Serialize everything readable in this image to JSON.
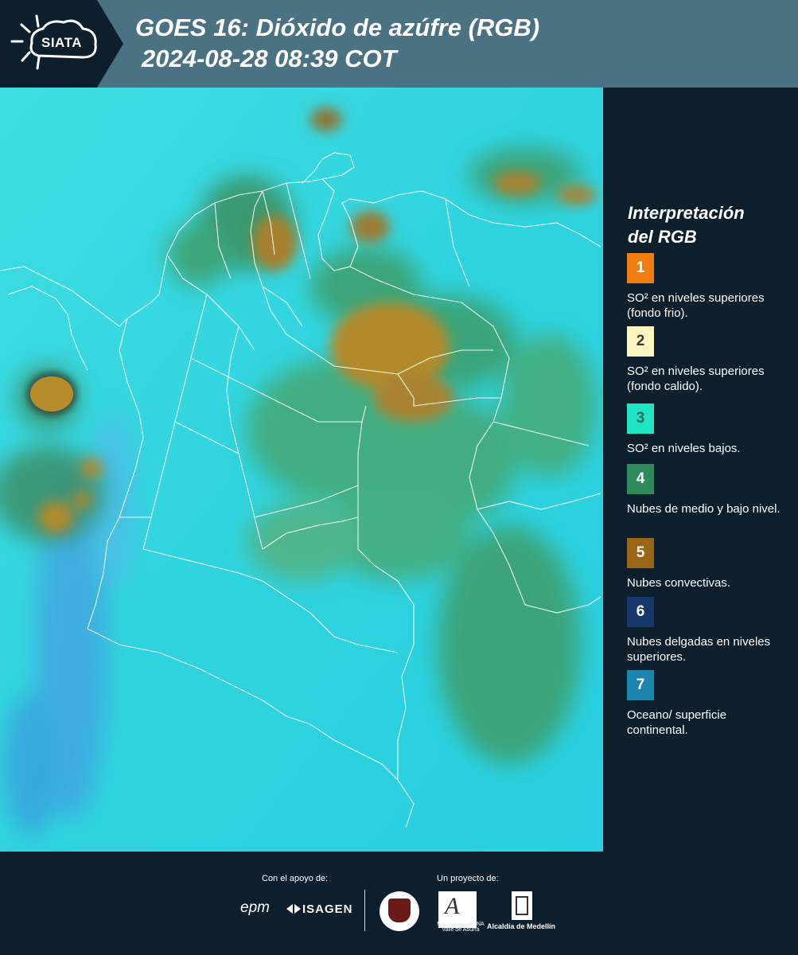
{
  "header": {
    "logo_text": "SIATA",
    "title_line1": "GOES 16: Dióxido de azúfre (RGB)",
    "title_line2": "2024-08-28 08:39 COT"
  },
  "legend": {
    "title_line1": "Interpretación",
    "title_line2": "del RGB",
    "items": [
      {
        "number": "1",
        "color": "#f07d10",
        "number_color": "#ffffff",
        "text": "SO² en niveles superiores (fondo frio)."
      },
      {
        "number": "2",
        "color": "#fdf5c0",
        "number_color": "#3a3a3a",
        "text": "SO² en niveles superiores (fondo calido)."
      },
      {
        "number": "3",
        "color": "#1ee6c4",
        "number_color": "#2a6a60",
        "text": "SO² en niveles bajos."
      },
      {
        "number": "4",
        "color": "#2f8a5c",
        "number_color": "#ffffff",
        "text": "Nubes de medio y bajo nivel."
      },
      {
        "number": "5",
        "color": "#9a6516",
        "number_color": "#ffffff",
        "text": "Nubes convectivas."
      },
      {
        "number": "6",
        "color": "#17386b",
        "number_color": "#ffffff",
        "text": "Nubes delgadas en niveles superiores."
      },
      {
        "number": "7",
        "color": "#1a86ad",
        "number_color": "#ffffff",
        "text": "Oceano/ superficie continental."
      }
    ]
  },
  "footer": {
    "support_label": "Con el apoyo de:",
    "project_label": "Un proyecto de:",
    "epm": "epm",
    "isagen": "ISAGEN",
    "area_text": "METROPOLITANA Valle de Aburrá",
    "alcaldia": "Alcaldía de Medellín"
  },
  "colors": {
    "background": "#0d1f2d",
    "header": "#4a7282",
    "map_base": "#33d4de",
    "convective": "#b38a2c",
    "mid_low_cloud": "#3e9a6a"
  }
}
